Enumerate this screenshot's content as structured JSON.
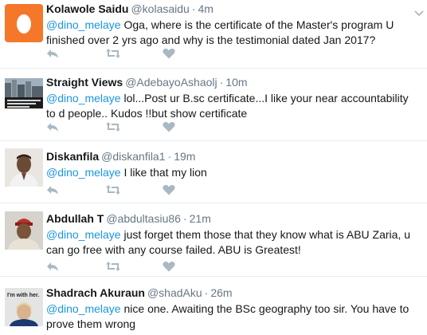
{
  "colors": {
    "mention": "#1b95e0",
    "meta": "#657786",
    "text": "#14171a",
    "icon": "#aab8c2",
    "divider": "#e6ecf0"
  },
  "tweets": [
    {
      "avatar": "orange-egg-avatar",
      "name": "Kolawole Saidu",
      "handle": "@kolasaidu",
      "sep": "·",
      "time": "4m",
      "mention": "@dino_melaye",
      "text": " Oga, where is the certificate of the Master's program U finished over 2 yrs ago and why is the testimonial dated Jan 2017?"
    },
    {
      "avatar": "city-photo-avatar",
      "name": "Straight Views",
      "handle": "@AdebayoAshaolj",
      "sep": "·",
      "time": "10m",
      "mention": "@dino_melaye",
      "text": " lol...Post ur  B.sc certificate...I like your near accountability to d people.. Kudos !!but show certificate"
    },
    {
      "avatar": "man-photo-avatar",
      "name": "Diskanfila",
      "handle": "@diskanfila1",
      "sep": "·",
      "time": "19m",
      "mention": "@dino_melaye",
      "text": " I like that my lion"
    },
    {
      "avatar": "man-cap-avatar",
      "name": "Abdullah T",
      "handle": "@abdultasiu86",
      "sep": "·",
      "time": "21m",
      "mention": "@dino_melaye",
      "text": " just forget them those that they know what is ABU Zaria, u can go free with any course failed. ABU is Greatest!"
    },
    {
      "avatar": "im-with-her-avatar",
      "avatar_text": "I'm with her.",
      "name": "Shadrach Akuraun",
      "handle": "@shadAku",
      "sep": "·",
      "time": "26m",
      "mention": "@dino_melaye",
      "text": " nice one. Awaiting the BSc geography too sir. You have to prove them wrong"
    }
  ],
  "action_icons": [
    "reply-icon",
    "retweet-icon",
    "like-icon"
  ]
}
